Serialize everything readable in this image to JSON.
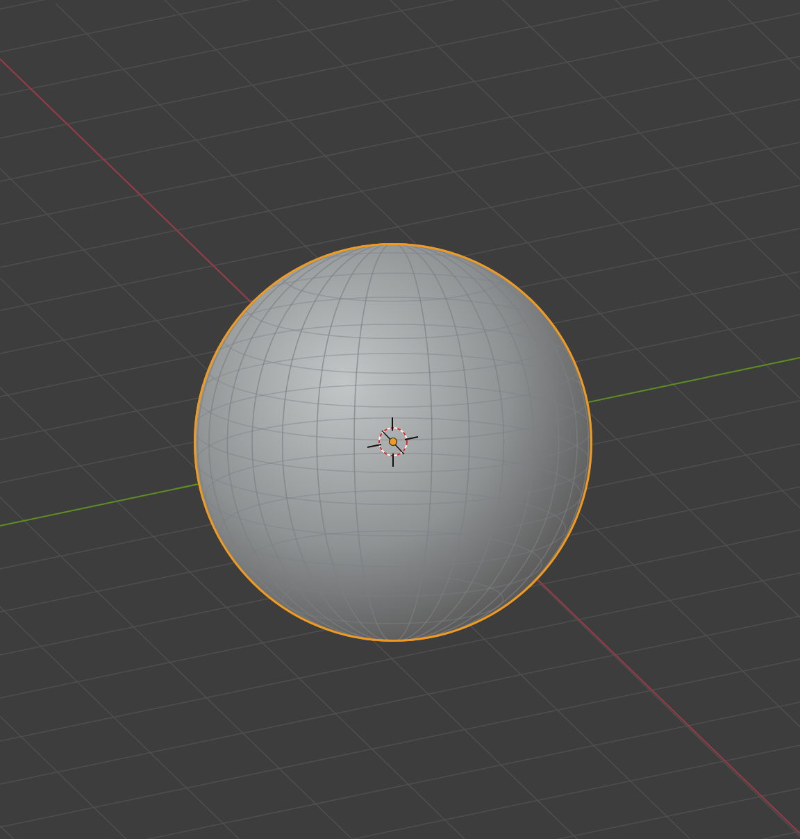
{
  "viewport": {
    "object": {
      "kind": "sphere",
      "selected": true
    },
    "cursor": {
      "visible": true
    }
  }
}
